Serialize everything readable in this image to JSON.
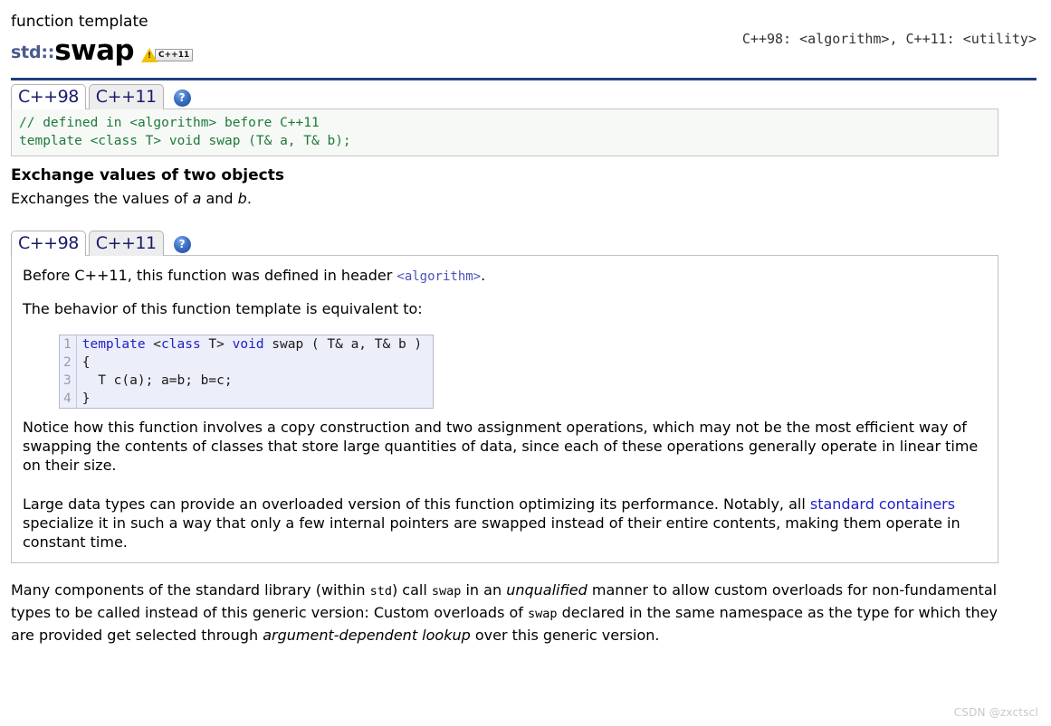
{
  "header": {
    "kind": "function template",
    "namespace": "std::",
    "name": "swap",
    "warning_icon": "warning-triangle-icon",
    "version_badge": "C++11",
    "headers_note": "C++98: <algorithm>, C++11: <utility>"
  },
  "signature_tabs": {
    "tabs": [
      {
        "label": "C++98",
        "active": true
      },
      {
        "label": "C++11",
        "active": false
      }
    ],
    "help_label": "?"
  },
  "signature_code": "// defined in <algorithm> before C++11\ntemplate <class T> void swap (T& a, T& b);",
  "section": {
    "title": "Exchange values of two objects",
    "description_pre": "Exchanges the values of ",
    "description_a": "a",
    "description_mid": " and ",
    "description_b": "b",
    "description_end": "."
  },
  "detail_tabs": {
    "tabs": [
      {
        "label": "C++98",
        "active": true
      },
      {
        "label": "C++11",
        "active": false
      }
    ],
    "help_label": "?"
  },
  "panel": {
    "para1_pre": "Before C++11, this function was defined in header ",
    "para1_header": "<algorithm>",
    "para1_post": ".",
    "para2": "The behavior of this function template is equivalent to:",
    "code": {
      "lines": [
        {
          "n": "1",
          "kw1": "template",
          "t1": " <",
          "kw2": "class",
          "t2": " T> ",
          "kw3": "void",
          "t3": " swap ( T& a, T& b )"
        },
        {
          "n": "2",
          "text": "{"
        },
        {
          "n": "3",
          "text": "  T c(a); a=b; b=c;"
        },
        {
          "n": "4",
          "text": "}"
        }
      ]
    },
    "para3": "Notice how this function involves a copy construction and two assignment operations, which may not be the most efficient way of swapping the contents of classes that store large quantities of data, since each of these operations generally operate in linear time on their size.",
    "para4_pre": "Large data types can provide an overloaded version of this function optimizing its performance. Notably, all ",
    "para4_link": "standard containers",
    "para4_post": " specialize it in such a way that only a few internal pointers are swapped instead of their entire contents, making them operate in constant time."
  },
  "outro": {
    "s1": "Many components of the standard library (within ",
    "s2": "std",
    "s3": ") call ",
    "s4": "swap",
    "s5": " in an ",
    "s6": "unqualified",
    "s7": " manner to allow custom overloads for non-fundamental types to be called instead of this generic version: Custom overloads of ",
    "s8": "swap",
    "s9": " declared in the same namespace as the type for which they are provided get selected through ",
    "s10": "argument-dependent lookup",
    "s11": " over this generic version."
  },
  "watermark": "CSDN @zxctscl",
  "colors": {
    "rule": "#233e7d",
    "namespace": "#4a5a8c",
    "signature_code": "#1d7a3c",
    "link": "#2222cc",
    "keyword": "#2121c4",
    "mono_blue": "#4a52b8"
  }
}
